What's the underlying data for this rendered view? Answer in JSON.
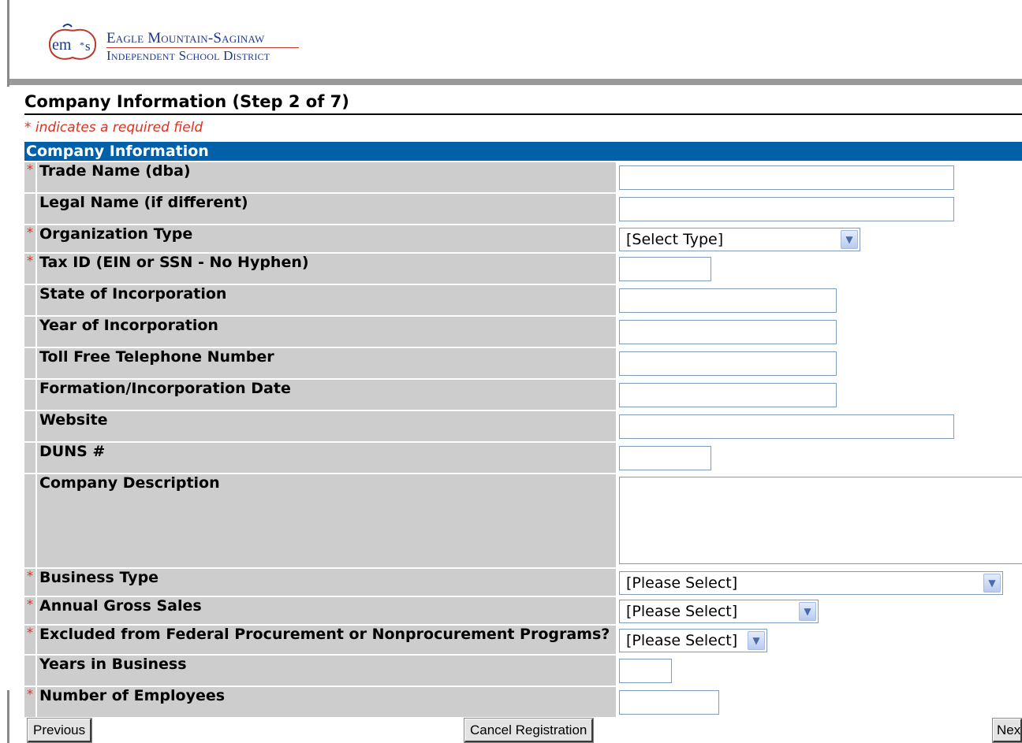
{
  "header": {
    "logo_initials": "em s",
    "logo_line1": "Eagle Mountain-Saginaw",
    "logo_line2": "Independent School District"
  },
  "page": {
    "title": "Company Information (Step 2 of 7)",
    "required_note": "* indicates a required field",
    "section_header": "Company Information"
  },
  "fields": [
    {
      "label": "Trade Name (dba)",
      "required": true,
      "control": "text"
    },
    {
      "label": "Legal Name (if different)",
      "required": false,
      "control": "text"
    },
    {
      "label": "Organization Type",
      "required": true,
      "control": "select",
      "value": "[Select Type]"
    },
    {
      "label": "Tax ID (EIN or SSN - No Hyphen)",
      "required": true,
      "control": "text"
    },
    {
      "label": "State of Incorporation",
      "required": false,
      "control": "text"
    },
    {
      "label": "Year of Incorporation",
      "required": false,
      "control": "text"
    },
    {
      "label": "Toll Free Telephone Number",
      "required": false,
      "control": "text"
    },
    {
      "label": "Formation/Incorporation Date",
      "required": false,
      "control": "text"
    },
    {
      "label": "Website",
      "required": false,
      "control": "text"
    },
    {
      "label": "DUNS #",
      "required": false,
      "control": "text"
    },
    {
      "label": "Company Description",
      "required": false,
      "control": "textarea"
    },
    {
      "label": "Business Type",
      "required": true,
      "control": "select",
      "value": "[Please Select]"
    },
    {
      "label": "Annual Gross Sales",
      "required": true,
      "control": "select",
      "value": "[Please Select]"
    },
    {
      "label": "Excluded from Federal Procurement or Nonprocurement Programs?",
      "required": true,
      "control": "select",
      "value": "[Please Select]"
    },
    {
      "label": "Years in Business",
      "required": false,
      "control": "text"
    },
    {
      "label": "Number of Employees",
      "required": true,
      "control": "text"
    }
  ],
  "required_marker": "*",
  "buttons": {
    "previous": "Previous",
    "cancel": "Cancel Registration",
    "next": "Next"
  },
  "icons": {
    "dropdown_arrow": "chevron-down-icon"
  }
}
